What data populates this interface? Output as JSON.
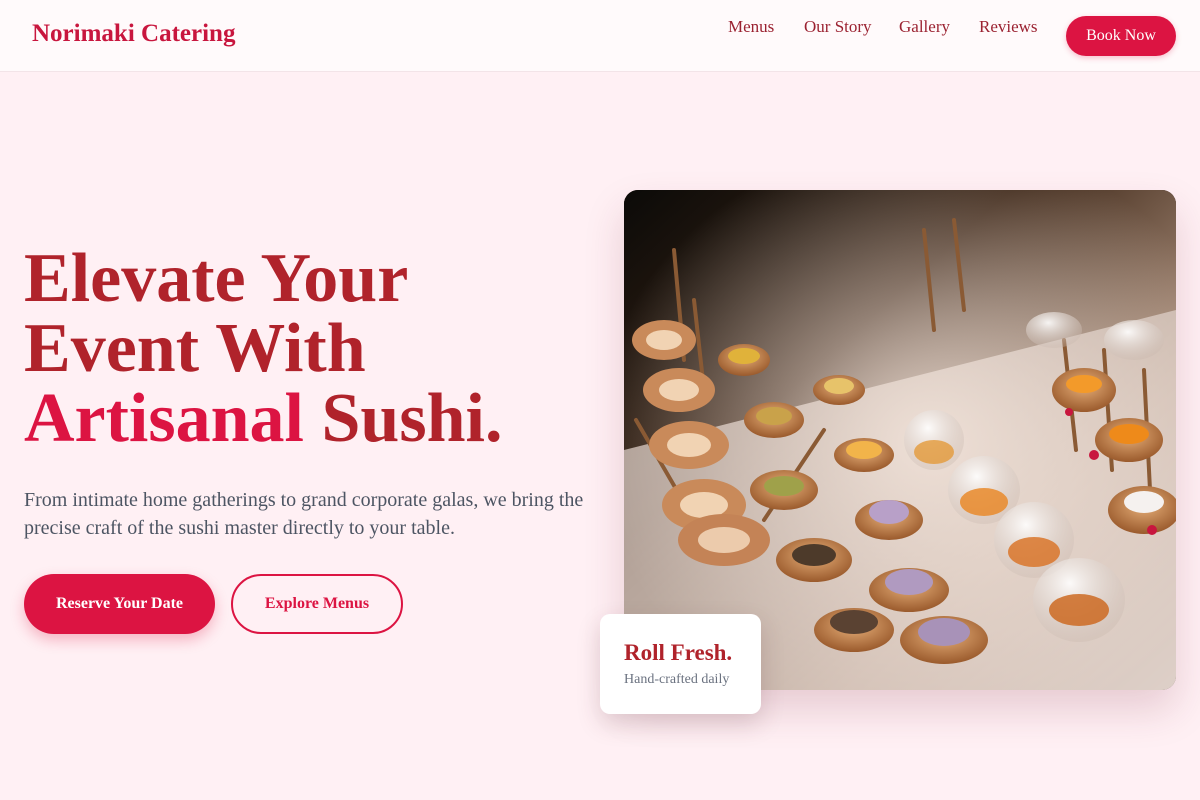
{
  "header": {
    "brand": "Norimaki Catering",
    "nav": [
      "Menus",
      "Our Story",
      "Gallery",
      "Reviews"
    ],
    "cta": "Book Now"
  },
  "hero": {
    "title_line1": "Elevate Your",
    "title_line2": "Event With",
    "title_accent": "Artisanal",
    "title_end": " Sushi.",
    "description": "From intimate home gatherings to grand corporate galas, we bring the precise craft of the sushi master directly to your table.",
    "primary_button": "Reserve Your Date",
    "secondary_button": "Explore Menus",
    "image_alt": "Catering platter of canapés, tarts and glass verrines"
  },
  "badge": {
    "title": "Roll Fresh.",
    "subtitle": "Hand-crafted daily"
  },
  "colors": {
    "accent": "#dc1442",
    "title": "#b0232b",
    "background": "#fff0f4",
    "body_text": "#4d5563"
  }
}
